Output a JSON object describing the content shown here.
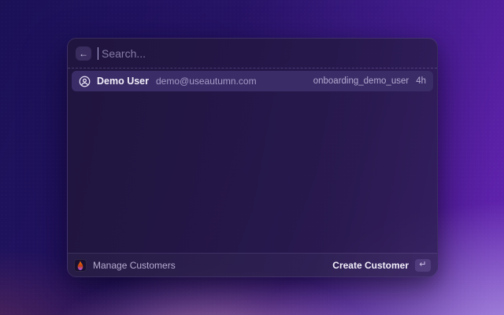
{
  "palette": {
    "back_glyph": "←",
    "search": {
      "placeholder": "Search...",
      "value": ""
    },
    "result": {
      "name": "Demo User",
      "email": "demo@useautumn.com",
      "tag": "onboarding_demo_user",
      "time": "4h"
    },
    "footer": {
      "context_label": "Manage Customers",
      "action_label": "Create Customer",
      "enter_glyph": "↵"
    }
  },
  "colors": {
    "bg_top_left": "#1a1157",
    "bg_top_right": "#5a20a6",
    "bg_bottom_pink": "#c68cb6",
    "bg_bottom_lavender": "#aa90e0",
    "modal_bg": "#20153d",
    "selected_row": "#3a2c67",
    "flame_top": "#f97316",
    "flame_bottom": "#a855f7"
  }
}
